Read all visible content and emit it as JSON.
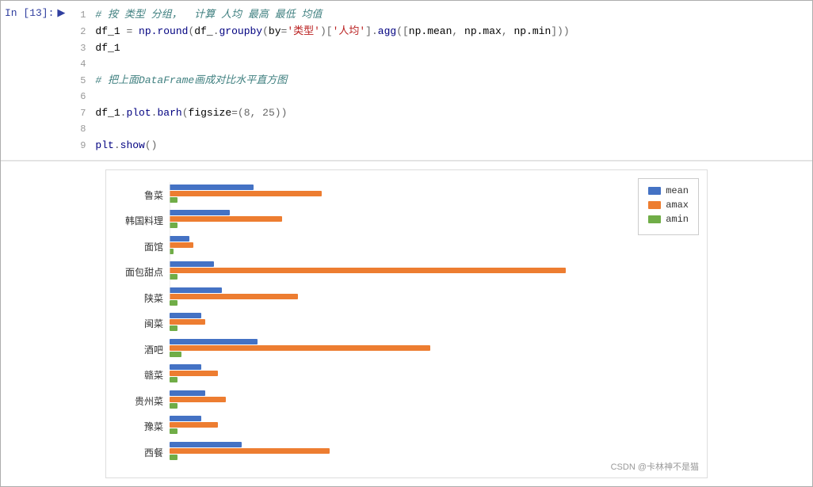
{
  "cell": {
    "prompt": "In  [13]:",
    "lines": [
      {
        "num": "1",
        "tokens": [
          {
            "type": "cm",
            "text": "# 按 类型 分组，  计算 人均 最高 最低 均值"
          }
        ]
      },
      {
        "num": "2",
        "tokens": [
          {
            "type": "var",
            "text": "df_1"
          },
          {
            "type": "op",
            "text": " = "
          },
          {
            "type": "fn",
            "text": "np.round"
          },
          {
            "type": "op",
            "text": "("
          },
          {
            "type": "var",
            "text": "df_"
          },
          {
            "type": "op",
            "text": "."
          },
          {
            "type": "fn",
            "text": "groupby"
          },
          {
            "type": "op",
            "text": "("
          },
          {
            "type": "var",
            "text": "by"
          },
          {
            "type": "op",
            "text": "="
          },
          {
            "type": "str",
            "text": "'类型'"
          },
          {
            "type": "op",
            "text": ")["
          },
          {
            "type": "str",
            "text": "'人均'"
          },
          {
            "type": "op",
            "text": "]."
          },
          {
            "type": "fn",
            "text": "agg"
          },
          {
            "type": "op",
            "text": "(["
          },
          {
            "type": "var",
            "text": "np.mean"
          },
          {
            "type": "op",
            "text": ", "
          },
          {
            "type": "var",
            "text": "np.max"
          },
          {
            "type": "op",
            "text": ", "
          },
          {
            "type": "var",
            "text": "np.min"
          },
          {
            "type": "op",
            "text": "]))"
          }
        ]
      },
      {
        "num": "3",
        "tokens": [
          {
            "type": "var",
            "text": "df_1"
          }
        ]
      },
      {
        "num": "4",
        "tokens": []
      },
      {
        "num": "5",
        "tokens": [
          {
            "type": "cm",
            "text": "# 把上面DataFrame画成对比水平直方图"
          }
        ]
      },
      {
        "num": "6",
        "tokens": []
      },
      {
        "num": "7",
        "tokens": [
          {
            "type": "var",
            "text": "df_1"
          },
          {
            "type": "op",
            "text": "."
          },
          {
            "type": "fn",
            "text": "plot"
          },
          {
            "type": "op",
            "text": "."
          },
          {
            "type": "fn",
            "text": "barh"
          },
          {
            "type": "op",
            "text": "("
          },
          {
            "type": "var",
            "text": "figsize"
          },
          {
            "type": "op",
            "text": "=("
          },
          {
            "type": "num",
            "text": "8"
          },
          {
            "type": "op",
            "text": ", "
          },
          {
            "type": "num",
            "text": "25"
          },
          {
            "type": "op",
            "text": "))"
          }
        ]
      },
      {
        "num": "8",
        "tokens": []
      },
      {
        "num": "9",
        "tokens": [
          {
            "type": "fn",
            "text": "plt"
          },
          {
            "type": "op",
            "text": "."
          },
          {
            "type": "fn",
            "text": "show"
          },
          {
            "type": "op",
            "text": "()"
          }
        ]
      }
    ],
    "chart": {
      "categories": [
        "鲁菜",
        "韩国料理",
        "面馆",
        "面包甜点",
        "陕菜",
        "闽菜",
        "酒吧",
        "赣菜",
        "贵州菜",
        "豫菜",
        "西餐"
      ],
      "legend": [
        {
          "label": "mean",
          "color": "#4472C4"
        },
        {
          "label": "amax",
          "color": "#ED7D31"
        },
        {
          "label": "amin",
          "color": "#70AD47"
        }
      ],
      "series": {
        "鲁菜": {
          "mean": 0.21,
          "amax": 0.38,
          "amin": 0.02
        },
        "韩国料理": {
          "mean": 0.15,
          "amax": 0.28,
          "amin": 0.02
        },
        "面馆": {
          "mean": 0.05,
          "amax": 0.06,
          "amin": 0.01
        },
        "面包甜点": {
          "mean": 0.11,
          "amax": 0.99,
          "amin": 0.02
        },
        "陕菜": {
          "mean": 0.13,
          "amax": 0.32,
          "amin": 0.02
        },
        "闽菜": {
          "mean": 0.08,
          "amax": 0.09,
          "amin": 0.02
        },
        "酒吧": {
          "mean": 0.22,
          "amax": 0.65,
          "amin": 0.03
        },
        "赣菜": {
          "mean": 0.08,
          "amax": 0.12,
          "amin": 0.02
        },
        "贵州菜": {
          "mean": 0.09,
          "amax": 0.14,
          "amin": 0.02
        },
        "豫菜": {
          "mean": 0.08,
          "amax": 0.12,
          "amin": 0.02
        },
        "西餐": {
          "mean": 0.18,
          "amax": 0.4,
          "amin": 0.02
        }
      },
      "watermark": "CSDN @卡林神不是猫"
    }
  }
}
